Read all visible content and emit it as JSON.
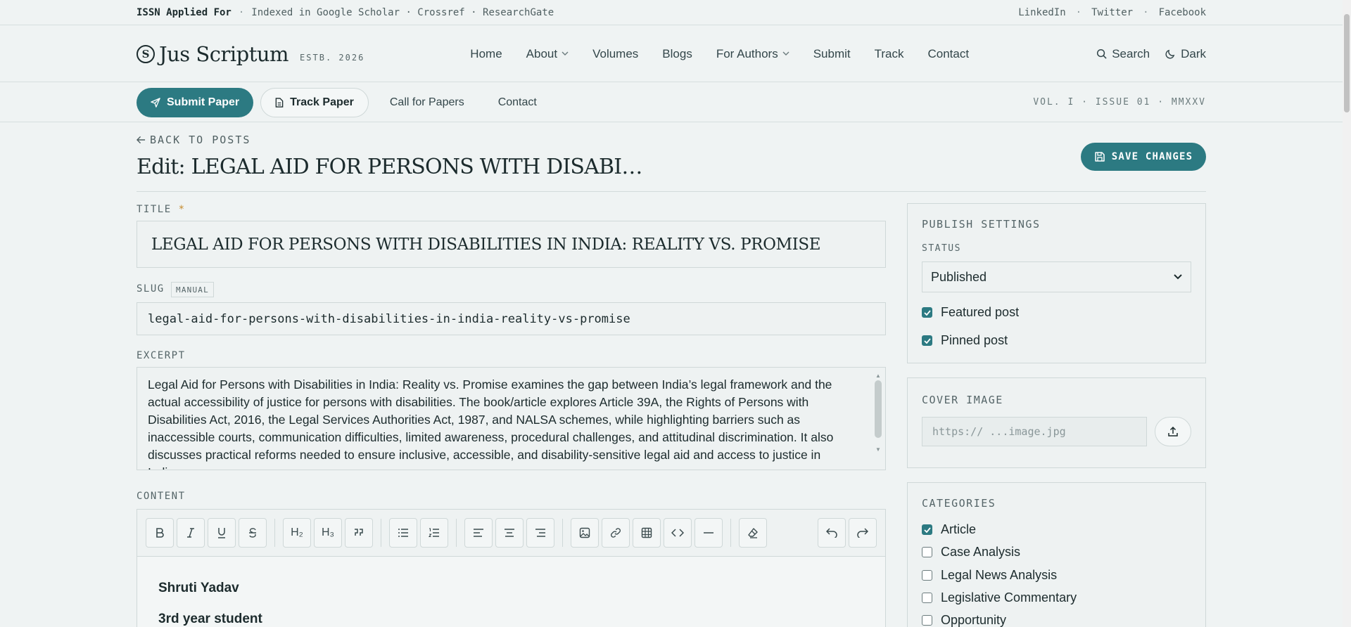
{
  "topstrip": {
    "issn": "ISSN Applied For",
    "indexed": "Indexed in Google Scholar · Crossref · ResearchGate",
    "social": [
      "LinkedIn",
      "Twitter",
      "Facebook"
    ]
  },
  "header": {
    "logo_mark": "S",
    "logo_text": "Jus Scriptum",
    "estb": "ESTB. 2026",
    "nav": [
      "Home",
      "About",
      "Volumes",
      "Blogs",
      "For Authors",
      "Submit",
      "Track",
      "Contact"
    ],
    "search": "Search",
    "dark": "Dark"
  },
  "subbar": {
    "submit": "Submit Paper",
    "track": "Track Paper",
    "call": "Call for Papers",
    "contact": "Contact",
    "vol": "VOL. I · ISSUE 01 · MMXXV"
  },
  "page": {
    "back": "BACK TO POSTS",
    "title": "Edit: LEGAL AID FOR PERSONS WITH DISABI…",
    "save": "SAVE CHANGES"
  },
  "form": {
    "title_label": "TITLE",
    "title_req": "*",
    "title_value": "LEGAL AID FOR PERSONS WITH DISABILITIES IN INDIA:  REALITY VS. PROMISE",
    "slug_label": "SLUG",
    "slug_badge": "MANUAL",
    "slug_value": "legal-aid-for-persons-with-disabilities-in-india-reality-vs-promise",
    "excerpt_label": "EXCERPT",
    "excerpt_value": "Legal Aid for Persons with Disabilities in India: Reality vs. Promise examines the gap between India’s legal framework and the actual accessibility of justice for persons with disabilities. The book/article explores Article 39A, the Rights of Persons with Disabilities Act, 2016, the Legal Services Authorities Act, 1987, and NALSA schemes, while highlighting barriers such as inaccessible courts, communication difficulties, limited awareness, procedural challenges, and attitudinal discrimination. It also discusses practical reforms needed to ensure inclusive, accessible, and disability-sensitive legal aid and access to justice in India.",
    "content_label": "CONTENT",
    "toolbar": {
      "h2": "H₂",
      "h3": "H₃"
    },
    "content_lines": [
      "Shruti Yadav",
      "3rd year student"
    ]
  },
  "publish": {
    "title": "PUBLISH SETTINGS",
    "status_label": "STATUS",
    "status_value": "Published",
    "featured": "Featured post",
    "pinned": "Pinned post"
  },
  "cover": {
    "title": "COVER IMAGE",
    "placeholder": "https:// ...image.jpg"
  },
  "categories": {
    "title": "CATEGORIES",
    "items": [
      {
        "label": "Article",
        "checked": true
      },
      {
        "label": "Case Analysis",
        "checked": false
      },
      {
        "label": "Legal News Analysis",
        "checked": false
      },
      {
        "label": "Legislative Commentary",
        "checked": false
      },
      {
        "label": "Opportunity",
        "checked": false
      }
    ]
  },
  "colors": {
    "accent": "#2c7a82",
    "background": "#eff3f3",
    "required": "#c58a2c"
  }
}
